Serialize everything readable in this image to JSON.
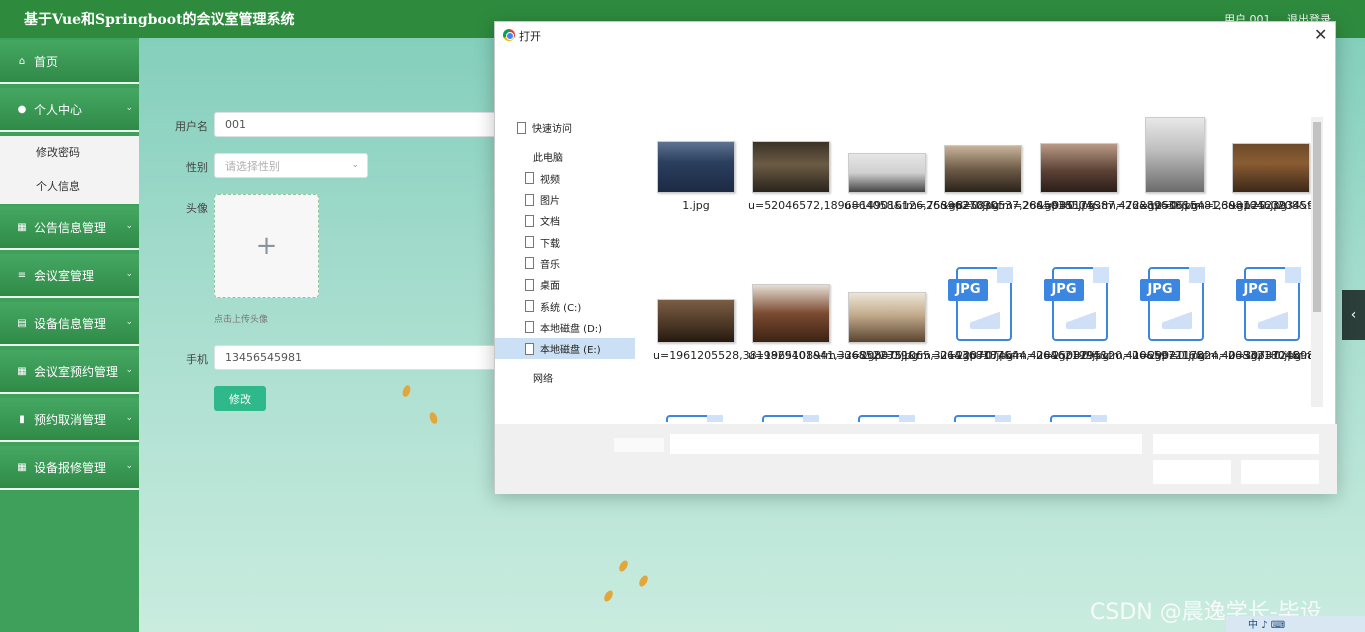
{
  "header": {
    "title": "基于Vue和Springboot的会议室管理系统",
    "user": "用户 001",
    "logout": "退出登录"
  },
  "sidebar": {
    "items": [
      {
        "label": "首页",
        "icon": "home-icon"
      },
      {
        "label": "个人中心",
        "icon": "user-icon",
        "submenu": [
          "修改密码",
          "个人信息"
        ]
      },
      {
        "label": "公告信息管理",
        "icon": "grid-icon"
      },
      {
        "label": "会议室管理",
        "icon": "list-icon"
      },
      {
        "label": "设备信息管理",
        "icon": "calendar-icon"
      },
      {
        "label": "会议室预约管理",
        "icon": "grid-icon"
      },
      {
        "label": "预约取消管理",
        "icon": "lock-icon"
      },
      {
        "label": "设备报修管理",
        "icon": "grid-icon"
      }
    ]
  },
  "form": {
    "username_label": "用户名",
    "username_value": "001",
    "gender_label": "性别",
    "gender_placeholder": "请选择性别",
    "avatar_label": "头像",
    "upload_tip": "点击上传头像",
    "phone_label": "手机",
    "phone_value": "13456545981",
    "submit_label": "修改"
  },
  "dialog": {
    "title": "打开",
    "nav": [
      {
        "label": "快速访问",
        "selected": false
      },
      {
        "label": "此电脑",
        "selected": false
      },
      {
        "label": "视频",
        "selected": false
      },
      {
        "label": "图片",
        "selected": false
      },
      {
        "label": "文档",
        "selected": false
      },
      {
        "label": "下载",
        "selected": false
      },
      {
        "label": "音乐",
        "selected": false
      },
      {
        "label": "桌面",
        "selected": false
      },
      {
        "label": "系统 (C:)",
        "selected": false
      },
      {
        "label": "本地磁盘 (D:)",
        "selected": false
      },
      {
        "label": "本地磁盘 (E:)",
        "selected": true
      },
      {
        "label": "网络",
        "selected": false
      }
    ],
    "files": [
      {
        "name": "1.jpg"
      },
      {
        "name": "u=52046572,1896864058&fm=26&gp=0.jpg"
      },
      {
        "name": "u=149016126,753962709&fm=26&gp=0.jpg"
      },
      {
        "name": "u=825830537,2845038504&fm=26&gp=0.jpg"
      },
      {
        "name": "u=985175387,472289638&fm=26&gp=0.jpg"
      },
      {
        "name": "u=1250615481,39810460208&fm=26&gp=0.jpg"
      },
      {
        "name": "u=1252393459,682408378&fm=26&gp=0.jpg"
      },
      {
        "name": "u=1961205528,3819829401&fm=26&gp=0.jpg"
      },
      {
        "name": "u=1965108941,3368522339&fm=26&gp=0.jpg"
      },
      {
        "name": "u=2080751065,3214368187&fm=26&gp=0.jpg"
      },
      {
        "name": "u=2207074644,4284621994&fm=26&gp=0.jpg"
      },
      {
        "name": "u=2508295120,4106597216&fm=26&gp=0.jpg"
      },
      {
        "name": "u=2902117824,4033321804&fm=26&gp=0.jpg"
      },
      {
        "name": "u=3073724898,882948973&fm=11&gp=0.jpg"
      }
    ],
    "jpg_badge": "JPG"
  },
  "watermark": "CSDN @晨逸学长-毕设",
  "tray": "中 ♪ ⌨"
}
